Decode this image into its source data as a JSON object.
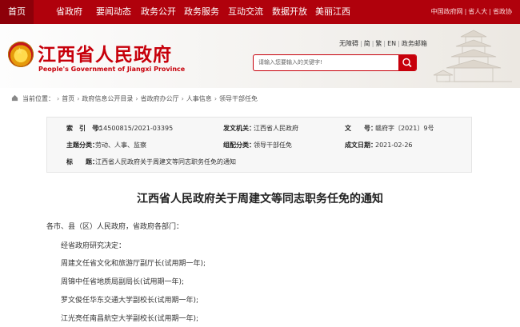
{
  "topnav": {
    "items": [
      "首页",
      "省政府",
      "要闻动态",
      "政务公开",
      "政务服务",
      "互动交流",
      "数据开放",
      "美丽江西"
    ],
    "links": [
      "中国政府网",
      "省人大",
      "省政协"
    ]
  },
  "header": {
    "title": "江西省人民政府",
    "subtitle": "People's Government of Jiangxi Province",
    "toolinks": [
      "无障碍",
      "简",
      "繁",
      "EN",
      "政务邮箱"
    ],
    "search_placeholder": "请输入您要输入的关键字!"
  },
  "breadcrumb": {
    "label": "当前位置：",
    "items": [
      "首页",
      "政府信息公开目录",
      "省政府办公厅",
      "人事信息",
      "领导干部任免"
    ]
  },
  "info": {
    "index_key": "索　引　号：",
    "index_val": "014500815/2021-03395",
    "org_key": "发文机关：",
    "org_val": "江西省人民政府",
    "docno_key": "文　　号：",
    "docno_val": "赣府字〔2021〕9号",
    "topic_key": "主题分类：",
    "topic_val": "劳动、人事、监察",
    "cat_key": "组配分类：",
    "cat_val": "领导干部任免",
    "date_key": "成文日期：",
    "date_val": "2021-02-26",
    "title_key": "标　　题：",
    "title_val": "江西省人民政府关于周建文等同志职务任免的通知"
  },
  "article": {
    "title": "江西省人民政府关于周建文等同志职务任免的通知",
    "salutation": "各市、县（区）人民政府，省政府各部门：",
    "lines": [
      "经省政府研究决定：",
      "周建文任省文化和旅游厅副厅长(试用期一年);",
      "周锦中任省地质局副局长(试用期一年);",
      "罗文俊任华东交通大学副校长(试用期一年);",
      "江光亮任南昌航空大学副校长(试用期一年);"
    ]
  },
  "colors": {
    "brand": "#b0010c",
    "title_red": "#c7000b"
  }
}
